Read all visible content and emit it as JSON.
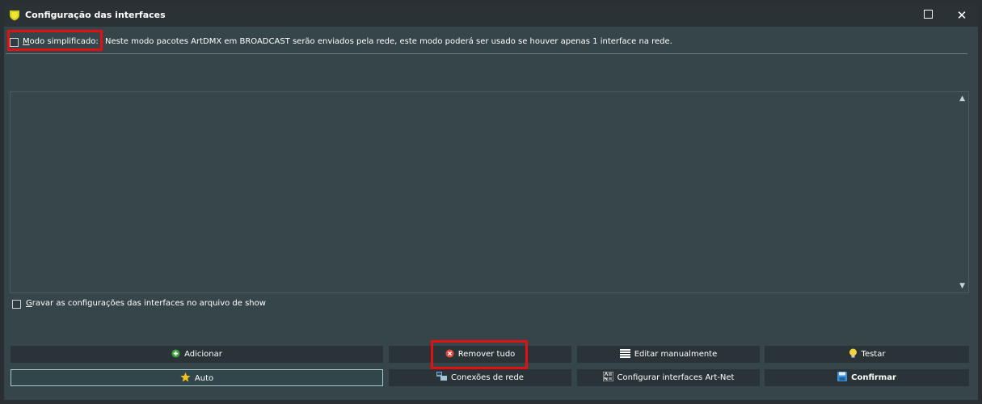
{
  "window": {
    "title": "Configuração das interfaces",
    "maximize_glyph": "□",
    "close_glyph": "✕"
  },
  "simplified": {
    "checked": false,
    "label": "Modo simplificado:",
    "description": "Neste modo pacotes ArtDMX em BROADCAST serão enviados pela rede, este modo poderá ser usado se houver apenas 1 interface na rede."
  },
  "list": {
    "items": []
  },
  "save_option": {
    "checked": false,
    "label": "Gravar as configurações das interfaces no arquivo de show"
  },
  "buttons": {
    "add": "Adicionar",
    "remove_all": "Remover tudo",
    "edit_manually": "Editar manualmente",
    "test": "Testar",
    "auto": "Auto",
    "network_connections": "Conexões de rede",
    "configure_artnet": "Configurar interfaces Art-Net",
    "confirm": "Confirmar"
  },
  "colors": {
    "highlight": "#e21010",
    "window_bg": "#36454a",
    "button_bg": "#2a3337"
  }
}
